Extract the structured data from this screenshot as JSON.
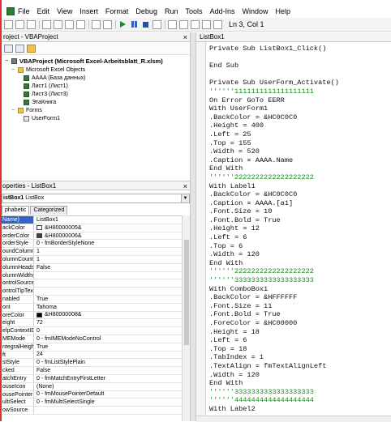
{
  "menu": [
    "File",
    "Edit",
    "View",
    "Insert",
    "Format",
    "Debug",
    "Run",
    "Tools",
    "Add-Ins",
    "Window",
    "Help"
  ],
  "toolbar": {
    "position": "Ln 3, Col 1"
  },
  "project": {
    "title": "roject - VBAProject",
    "close": "×",
    "tree": [
      {
        "label": "VBAProject (Microsoft Excel-Arbeitsblatt_R.xlsm)",
        "icon": "vba",
        "expander": "−",
        "bold": true
      },
      {
        "label": "Microsoft Excel Objects",
        "icon": "folder",
        "expander": "−"
      },
      {
        "label": "AAAA (База данных)",
        "icon": "xls"
      },
      {
        "label": "Лист1 (Лист1)",
        "icon": "xls"
      },
      {
        "label": "Лист3 (Лист3)",
        "icon": "xls"
      },
      {
        "label": "ЭтаКнига",
        "icon": "xls"
      },
      {
        "label": "Forms",
        "icon": "folder",
        "expander": "−"
      },
      {
        "label": "UserForm1",
        "icon": "form"
      }
    ]
  },
  "properties": {
    "title": "operties - ListBox1",
    "close": "×",
    "combo_name": "istBox1",
    "combo_type": "ListBox",
    "tabs": [
      "phabetic",
      "Categorized"
    ],
    "rows": [
      {
        "name": "Name)",
        "value": "ListBox1",
        "selected": true
      },
      {
        "name": "ackColor",
        "value": "&H80000005&",
        "swatch": "#ffffff"
      },
      {
        "name": "orderColor",
        "value": "&H80000006&",
        "swatch": "#404040"
      },
      {
        "name": "orderStyle",
        "value": "0 - fmBorderStyleNone"
      },
      {
        "name": "oundColumn",
        "value": "1"
      },
      {
        "name": "olumnCount",
        "value": "1"
      },
      {
        "name": "olumnHeads",
        "value": "False"
      },
      {
        "name": "olumnWidths",
        "value": ""
      },
      {
        "name": "ontrolSource",
        "value": ""
      },
      {
        "name": "ontrolTipText",
        "value": ""
      },
      {
        "name": "nabled",
        "value": "True"
      },
      {
        "name": "ont",
        "value": "Tahoma"
      },
      {
        "name": "oreColor",
        "value": "&H80000008&",
        "swatch": "#000000"
      },
      {
        "name": "eight",
        "value": "72"
      },
      {
        "name": "elpContextID",
        "value": "0"
      },
      {
        "name": "MEMode",
        "value": "0 - fmIMEModeNoControl"
      },
      {
        "name": "ntegralHeight",
        "value": "True"
      },
      {
        "name": "ft",
        "value": "24"
      },
      {
        "name": "stStyle",
        "value": "0 - fmListStylePlain"
      },
      {
        "name": "cked",
        "value": "False"
      },
      {
        "name": "atchEntry",
        "value": "0 - fmMatchEntryFirstLetter"
      },
      {
        "name": "ouseIcon",
        "value": "(None)"
      },
      {
        "name": "ousePointer",
        "value": "0 - fmMousePointerDefault"
      },
      {
        "name": "ultiSelect",
        "value": "0 - fmMultiSelectSingle"
      },
      {
        "name": "owSource",
        "value": ""
      }
    ]
  },
  "code": {
    "title": "ListBox1",
    "lines": [
      "Private Sub ListBox1_Click()",
      "",
      "End Sub",
      "",
      "Private Sub UserForm_Activate()",
      "''''''1111111111111111111",
      "On Error GoTo EERR",
      "With UserForm1",
      ".BackColor = &HC0C0C0",
      ".Height = 400",
      ".Left = 25",
      ".Top = 155",
      ".Width = 520",
      ".Caption = AAAA.Name",
      "End With",
      "''''''2222222222222222222",
      "With Label1",
      ".BackColor = &HC0C0C0",
      ".Caption = AAAA.[a1]",
      ".Font.Size = 10",
      ".Font.Bold = True",
      ".Height = 12",
      ".Left = 6",
      ".Top = 6",
      ".Width = 120",
      "End With",
      "''''''2222222222222222222",
      "''''''3333333333333333333",
      "With ComboBox1",
      ".BackColor = &HFFFFFF",
      ".Font.Size = 11",
      ".Font.Bold = True",
      ".ForeColor = &HC00000",
      ".Height = 18",
      ".Left = 6",
      ".Top = 18",
      ".TabIndex = 1",
      ".TextAlign = fmTextAlignLeft",
      ".Width = 120",
      "End With",
      "''''''3333333333333333333",
      "''''''4444444444444444444",
      "With Label2"
    ]
  }
}
